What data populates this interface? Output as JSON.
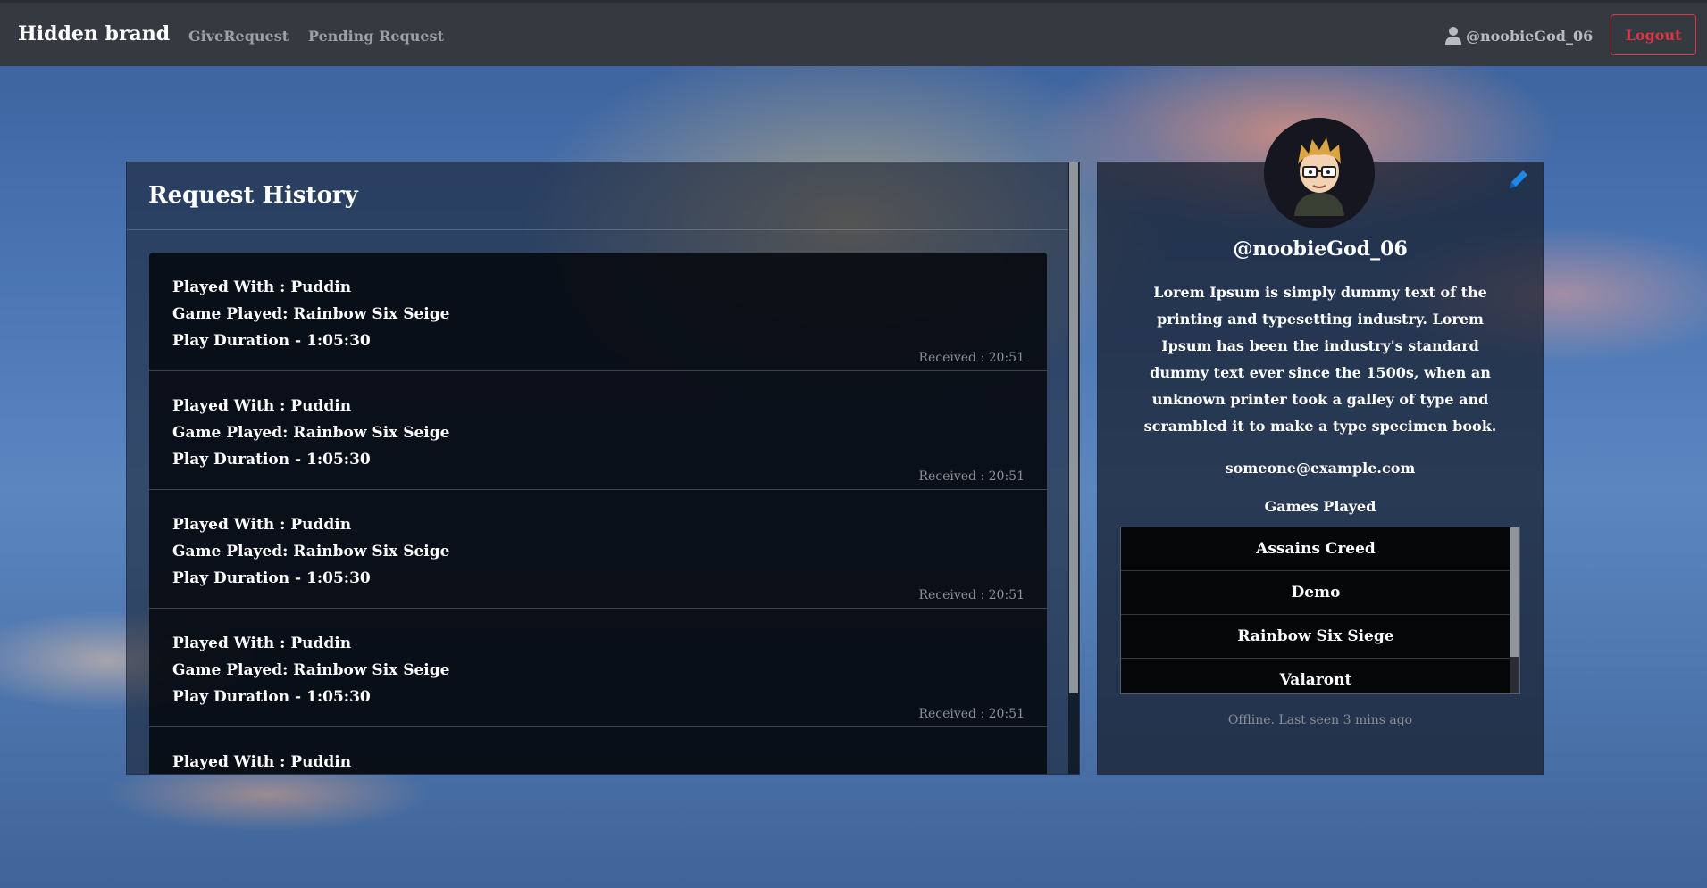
{
  "navbar": {
    "brand": "Hidden brand",
    "links": [
      "GiveRequest",
      "Pending Request"
    ],
    "username": "@noobieGod_06",
    "logout_label": "Logout"
  },
  "history": {
    "title": "Request History",
    "items": [
      {
        "played_with": "Played With : Puddin",
        "game": "Game Played: Rainbow Six Seige",
        "duration": "Play Duration - 1:05:30",
        "received": "Received : 20:51"
      },
      {
        "played_with": "Played With : Puddin",
        "game": "Game Played: Rainbow Six Seige",
        "duration": "Play Duration - 1:05:30",
        "received": "Received : 20:51"
      },
      {
        "played_with": "Played With : Puddin",
        "game": "Game Played: Rainbow Six Seige",
        "duration": "Play Duration - 1:05:30",
        "received": "Received : 20:51"
      },
      {
        "played_with": "Played With : Puddin",
        "game": "Game Played: Rainbow Six Seige",
        "duration": "Play Duration - 1:05:30",
        "received": "Received : 20:51"
      },
      {
        "played_with": "Played With : Puddin",
        "game": "",
        "duration": "",
        "received": ""
      }
    ]
  },
  "profile": {
    "username": "@noobieGod_06",
    "bio": "Lorem Ipsum is simply dummy text of the printing and typesetting industry. Lorem Ipsum has been the industry's standard dummy text ever since the 1500s, when an unknown printer took a galley of type and scrambled it to make a type specimen book.",
    "email": "someone@example.com",
    "games_title": "Games Played",
    "games": [
      "Assains Creed",
      "Demo",
      "Rainbow Six Siege",
      "Valaront"
    ],
    "status": "Offline. Last seen 3 mins ago",
    "edit_icon": "pencil-icon",
    "accent_color": "#1e88e5"
  },
  "colors": {
    "navbar_bg": "#343a40",
    "logout": "#dc3545"
  }
}
